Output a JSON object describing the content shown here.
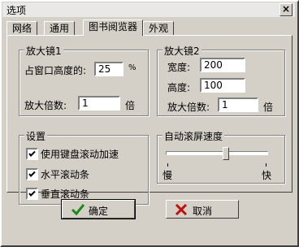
{
  "window": {
    "title": "选项",
    "close_label": "×"
  },
  "tabs": [
    {
      "label": "网络"
    },
    {
      "label": "通用"
    },
    {
      "label": "图书阅览器",
      "active": true
    },
    {
      "label": "外观"
    }
  ],
  "magnifier1": {
    "title": "放大镜1",
    "height_label": "占窗口高度的:",
    "height_value": "25",
    "percent_symbol": "%",
    "zoom_label": "放大倍数:",
    "zoom_value": "1",
    "zoom_unit": "倍"
  },
  "magnifier2": {
    "title": "放大镜2",
    "width_label": "宽度:",
    "width_value": "200",
    "height_label": "高度:",
    "height_value": "100",
    "zoom_label": "放大倍数:",
    "zoom_value": "1",
    "zoom_unit": "倍"
  },
  "settings": {
    "title": "设置",
    "options": [
      {
        "label": "使用键盘滚动加速",
        "checked": true
      },
      {
        "label": "水平滚动条",
        "checked": true
      },
      {
        "label": "垂直滚动条",
        "checked": true
      }
    ]
  },
  "autoscroll": {
    "title": "自动滚屏速度",
    "slow_label": "慢",
    "fast_label": "快",
    "level": 0.62
  },
  "buttons": {
    "ok_label": "确定",
    "cancel_label": "取消"
  }
}
